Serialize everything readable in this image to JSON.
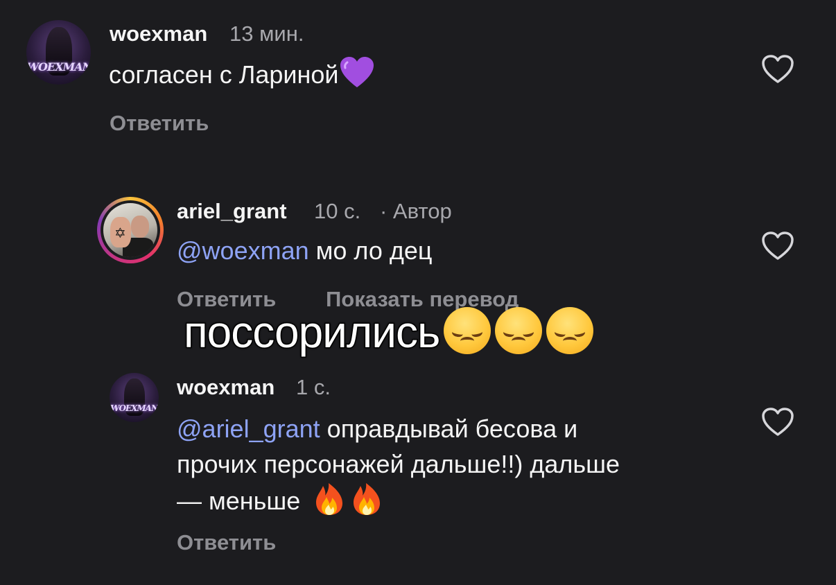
{
  "comments": [
    {
      "username": "woexman",
      "time": "13 мин.",
      "avatar_logo": "WOEXMAN",
      "text": "согласен с Лариной",
      "emoji": "purple-heart",
      "reply_label": "Ответить"
    },
    {
      "username": "ariel_grant",
      "time": "10 с.",
      "author_badge": "· Автор",
      "mention": "@woexman",
      "text": "мо ло дец",
      "reply_label": "Ответить",
      "translate_label": "Показать перевод"
    },
    {
      "username": "woexman",
      "time": "1 с.",
      "avatar_logo": "WOEXMAN",
      "mention": "@ariel_grant",
      "text_line1": "оправдывай бесова и",
      "text_line2": "прочих персонажей дальше!!) дальше",
      "text_line3": "— меньше",
      "emoji": "fire",
      "reply_label": "Ответить"
    }
  ],
  "overlay": {
    "text": "поссорились",
    "emoji": "pensive-face"
  },
  "colors": {
    "background": "#1c1c1f",
    "mention": "#8ea3f5",
    "muted": "#a8a8ad"
  },
  "icons": {
    "like": "heart-outline-icon"
  }
}
